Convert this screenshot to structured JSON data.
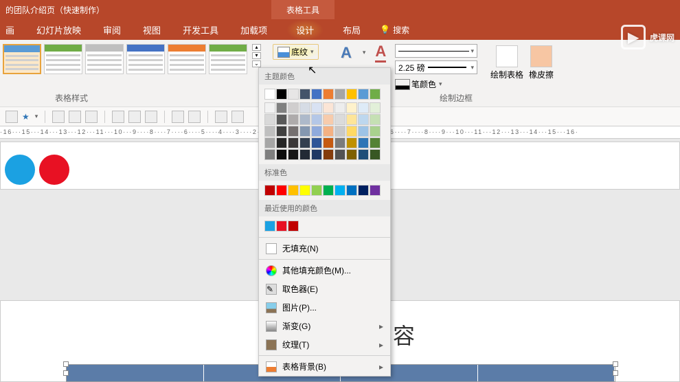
{
  "title": "的团队介绍页（快速制作）",
  "contextTab": "表格工具",
  "tabs": [
    "画",
    "幻灯片放映",
    "审阅",
    "视图",
    "开发工具",
    "加载项",
    "设计",
    "布局"
  ],
  "search": "搜索",
  "groups": {
    "styles": "表格样式",
    "borders": "绘制边框"
  },
  "shading": {
    "label": "底纹"
  },
  "penWeight": "2.25 磅",
  "penColor": "笔颜色",
  "drawTable": "绘制表格",
  "eraser": "橡皮擦",
  "dropdown": {
    "themeLabel": "主题颜色",
    "themeTop": [
      "#ffffff",
      "#000000",
      "#e7e6e6",
      "#44546a",
      "#4472c4",
      "#ed7d31",
      "#a5a5a5",
      "#ffc000",
      "#5b9bd5",
      "#70ad47"
    ],
    "themeShades": [
      [
        "#f2f2f2",
        "#808080",
        "#d0cece",
        "#d6dce5",
        "#d9e2f3",
        "#fbe5d6",
        "#ededed",
        "#fff2cc",
        "#deebf7",
        "#e2f0d9"
      ],
      [
        "#d9d9d9",
        "#595959",
        "#aeabab",
        "#adb9ca",
        "#b4c7e7",
        "#f7cbac",
        "#dbdbdb",
        "#fee599",
        "#bdd7ee",
        "#c5e0b4"
      ],
      [
        "#bfbfbf",
        "#404040",
        "#757070",
        "#8497b0",
        "#8faadc",
        "#f4b183",
        "#c9c9c9",
        "#ffd965",
        "#9dc3e6",
        "#a9d18e"
      ],
      [
        "#a6a6a6",
        "#262626",
        "#3b3838",
        "#333f50",
        "#2f5597",
        "#c55a11",
        "#7b7b7b",
        "#bf9000",
        "#2e75b6",
        "#548235"
      ],
      [
        "#7f7f7f",
        "#0d0d0d",
        "#171616",
        "#222a35",
        "#1f3864",
        "#843c0c",
        "#525252",
        "#7f6000",
        "#1f4e79",
        "#385723"
      ]
    ],
    "standardLabel": "标准色",
    "standard": [
      "#c00000",
      "#ff0000",
      "#ffc000",
      "#ffff00",
      "#92d050",
      "#00b050",
      "#00b0f0",
      "#0070c0",
      "#002060",
      "#7030a0"
    ],
    "recentLabel": "最近使用的颜色",
    "recent": [
      "#1ba1e2",
      "#e81123",
      "#c00000"
    ],
    "noFill": "无填充(N)",
    "moreColors": "其他填充颜色(M)...",
    "eyedropper": "取色器(E)",
    "picture": "图片(P)...",
    "gradient": "渐变(G)",
    "texture": "纹理(T)",
    "tableBg": "表格背景(B)"
  },
  "canvas": {
    "textFragment": "容"
  },
  "ruler": "·16···15···14···13···12···11···10···9····8····7····6····5····4····3····2····1····0····1····2····3····4····5····6····7····8····9···10···11···12···13···14···15···16·",
  "watermark": "虎课网",
  "tableStyles": [
    {
      "hdr": "#5b9bd5"
    },
    {
      "hdr": "#6fac46"
    },
    {
      "hdr": "#bfbfbf"
    },
    {
      "hdr": "#4472c4"
    },
    {
      "hdr": "#ed7d31"
    },
    {
      "hdr": "#70ad47"
    }
  ]
}
